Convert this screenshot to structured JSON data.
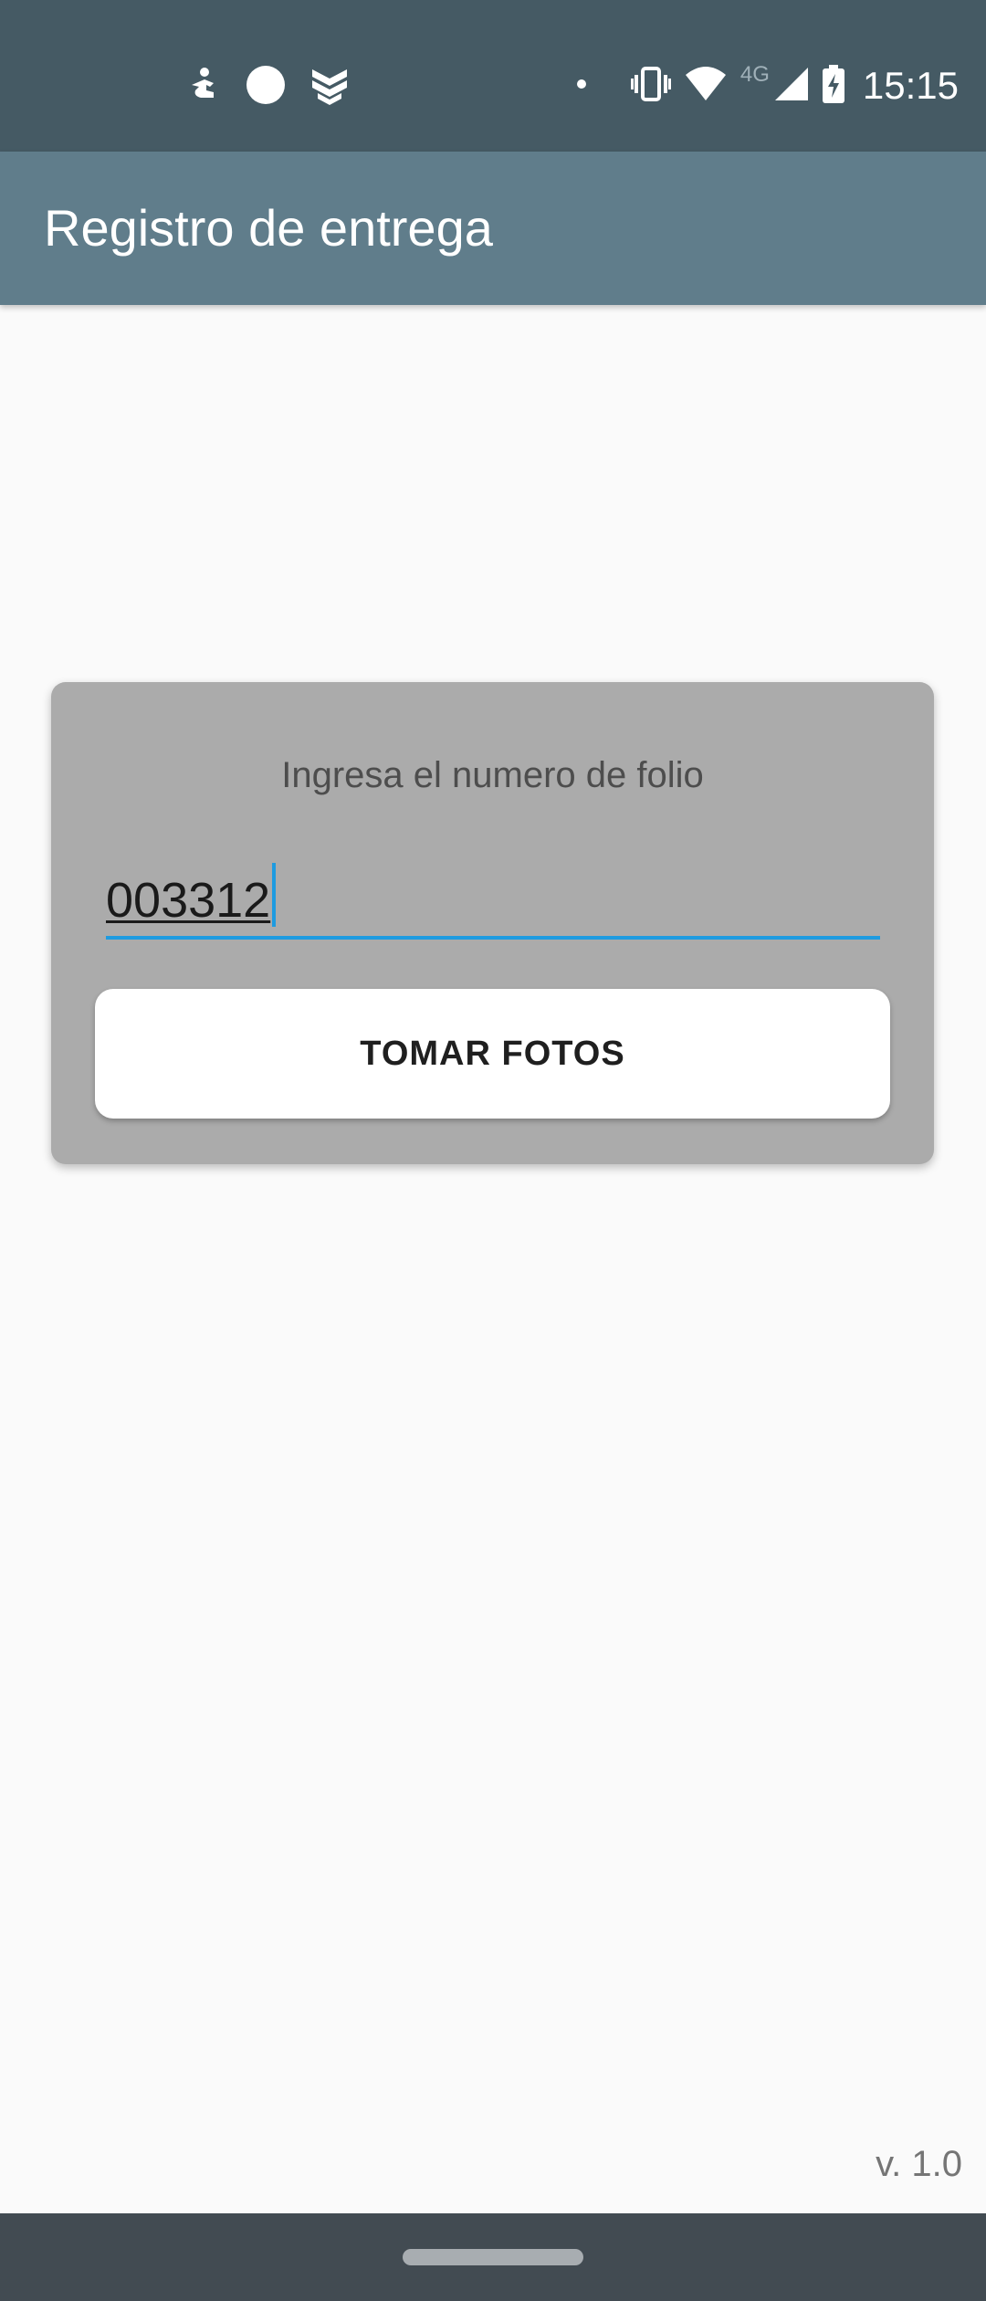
{
  "status_bar": {
    "time": "15:15",
    "network_type": "4G",
    "left_icons": [
      "accessibility-icon",
      "record-dot-icon",
      "rank-chevrons-icon"
    ],
    "right_icons": [
      "notification-dot-icon",
      "vibrate-icon",
      "wifi-icon",
      "cell-signal-icon",
      "battery-charging-icon"
    ]
  },
  "app_bar": {
    "title": "Registro de entrega",
    "color": "#607d8b"
  },
  "folio_card": {
    "label": "Ingresa el numero de folio",
    "input_value": "003312",
    "button_label": "TOMAR FOTOS",
    "accent_color": "#1e9be0"
  },
  "footer": {
    "version": "v. 1.0"
  }
}
